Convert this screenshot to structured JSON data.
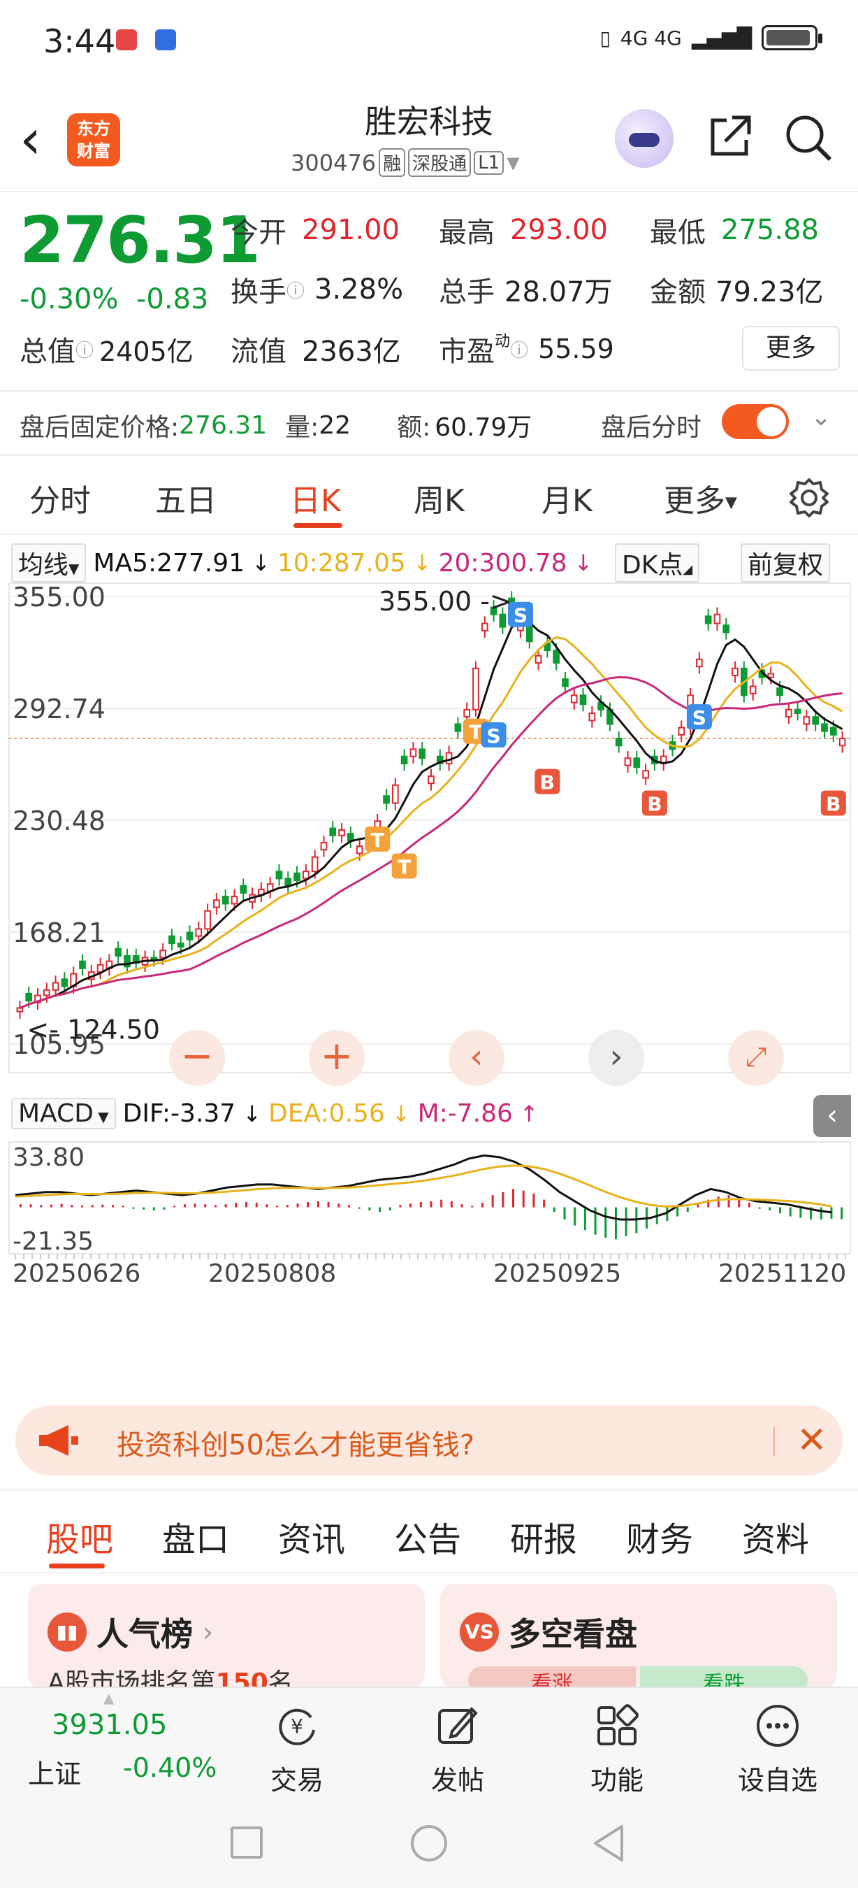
{
  "status_bar": {
    "time": "3:44",
    "network": "4G 4G"
  },
  "header": {
    "stock_name": "胜宏科技",
    "stock_code": "300476",
    "tags": [
      "融",
      "深股通",
      "L1"
    ],
    "logo_text_1": "东方",
    "logo_text_2": "财富"
  },
  "quote": {
    "price": "276.31",
    "change_pct": "-0.30%",
    "change_val": "-0.83",
    "open_label": "今开",
    "open": "291.00",
    "high_label": "最高",
    "high": "293.00",
    "low_label": "最低",
    "low": "275.88",
    "turnover_label": "换手",
    "turnover": "3.28%",
    "volume_label": "总手",
    "volume": "28.07万",
    "amount_label": "金额",
    "amount": "79.23亿",
    "mktcap_label": "总值",
    "mktcap": "2405亿",
    "float_label": "流值",
    "float": "2363亿",
    "pe_label": "市盈",
    "pe_sup": "动",
    "pe": "55.59",
    "more_label": "更多"
  },
  "after_hours": {
    "price_label": "盘后固定价格:",
    "price": "276.31",
    "qty_label": "量:",
    "qty": "22",
    "amount_label": "额:",
    "amount": "60.79万",
    "toggle_label": "盘后分时",
    "toggle_on": true
  },
  "period_tabs": [
    "分时",
    "五日",
    "日K",
    "周K",
    "月K",
    "更多"
  ],
  "active_period": "日K",
  "ma_bar": {
    "selector": "均线",
    "ma5": "MA5:277.91",
    "ma10": "10:287.05",
    "ma20": "20:300.78",
    "dk_label": "DK点",
    "adjust_label": "前复权"
  },
  "colors": {
    "up": "#e0262e",
    "down": "#0e9b34",
    "accent": "#e8401f",
    "ma5": "#111111",
    "ma10": "#e8b21d",
    "ma20": "#c8287a"
  },
  "chart_data": {
    "type": "candlestick",
    "y_labels": [
      "355.00",
      "292.74",
      "230.48",
      "168.21",
      "105.95"
    ],
    "ylim": [
      105.95,
      355.0
    ],
    "max_label": "355.00",
    "min_label": "124.50",
    "x_labels": [
      "20250626",
      "20250808",
      "20250925",
      "20251120"
    ],
    "markers": {
      "T": [
        "T",
        "T",
        "T",
        "T"
      ],
      "S": [
        "S",
        "S",
        "S"
      ],
      "B": [
        "B",
        "B",
        "B"
      ]
    },
    "closes": [
      126,
      130,
      133,
      136,
      140,
      138,
      145,
      148,
      146,
      150,
      152,
      155,
      149,
      151,
      154,
      153,
      158,
      162,
      160,
      164,
      170,
      180,
      186,
      184,
      188,
      190,
      189,
      192,
      195,
      198,
      194,
      197,
      202,
      210,
      218,
      222,
      225,
      219,
      216,
      222,
      230,
      240,
      250,
      262,
      270,
      265,
      255,
      262,
      268,
      280,
      292,
      315,
      340,
      345,
      338,
      350,
      340,
      330,
      322,
      325,
      318,
      305,
      300,
      295,
      290,
      292,
      284,
      272,
      265,
      260,
      258,
      262,
      266,
      270,
      282,
      300,
      320,
      340,
      345,
      335,
      315,
      300,
      305,
      310,
      312,
      300,
      292,
      290,
      288,
      284,
      280,
      278,
      276
    ],
    "macd": {
      "dif_label": "DIF:-3.37",
      "dea_label": "DEA:0.56",
      "m_label": "M:-7.86",
      "y_labels": [
        "33.80",
        "-21.35"
      ],
      "ylim": [
        -21.35,
        33.8
      ],
      "hist": [
        2,
        2,
        1.5,
        1.8,
        2.2,
        1.6,
        1.2,
        1.5,
        1.8,
        1.5,
        1.0,
        -1.0,
        -1.5,
        -2.0,
        -1.5,
        1.0,
        2.0,
        2.5,
        2.0,
        1.5,
        2.0,
        3.0,
        3.5,
        3.0,
        2.0,
        1.0,
        1.5,
        2.5,
        3.5,
        4.0,
        3.5,
        2.5,
        1.5,
        -1.0,
        -2.0,
        -3.0,
        -2.0,
        1.5,
        2.5,
        3.5,
        4.0,
        5.0,
        4.0,
        2.0,
        1.0,
        3.0,
        8.0,
        10.0,
        12.0,
        11.0,
        9.0,
        5.0,
        -3.0,
        -8.0,
        -12.0,
        -15.0,
        -18.0,
        -20.0,
        -21.0,
        -19.0,
        -17.0,
        -14.0,
        -11.0,
        -9.0,
        -6.0,
        -3.0,
        2.0,
        5.0,
        7.0,
        8.0,
        6.0,
        3.0,
        -1.0,
        -2.0,
        -4.0,
        -6.0,
        -7.0,
        -8.0,
        -8.0,
        -7.5,
        -7.86
      ],
      "dif": [
        8,
        9,
        10,
        10,
        9,
        8,
        9,
        10,
        11,
        10,
        9,
        8,
        9,
        11,
        13,
        14,
        15,
        15,
        14,
        13,
        12,
        13,
        14,
        16,
        18,
        19,
        20,
        22,
        25,
        28,
        32,
        34,
        33,
        30,
        25,
        18,
        10,
        4,
        -2,
        -6,
        -8,
        -8,
        -7,
        -4,
        2,
        8,
        12,
        10,
        6,
        4,
        3,
        2,
        0,
        -2,
        -3.37
      ],
      "dea": [
        7,
        7.5,
        8,
        8.5,
        8.8,
        8.7,
        8.7,
        9,
        9.4,
        9.6,
        9.5,
        9.2,
        9.2,
        9.6,
        10.3,
        11.1,
        11.9,
        12.5,
        12.8,
        12.8,
        12.6,
        12.7,
        13,
        13.6,
        14.5,
        15.4,
        16.3,
        17.5,
        19,
        20.8,
        23,
        25.2,
        26.8,
        27.4,
        26.9,
        25.1,
        22.1,
        18.5,
        14.4,
        10.3,
        6.6,
        3.7,
        1.6,
        0.5,
        0.8,
        2.2,
        4.2,
        5.3,
        5.4,
        5.1,
        4.7,
        4.2,
        3.4,
        2.3,
        0.56
      ]
    }
  },
  "macd_bar": {
    "selector": "MACD"
  },
  "ad_banner": {
    "text": "投资科创50怎么才能更省钱?"
  },
  "content_tabs": [
    "股吧",
    "盘口",
    "资讯",
    "公告",
    "研报",
    "财务",
    "资料"
  ],
  "active_content_tab": "股吧",
  "cards": {
    "popularity_title": "人气榜",
    "popularity_sub_prefix": "A股市场排名第",
    "popularity_rank": "150",
    "popularity_sub_suffix": "名",
    "bullbear_title": "多空看盘",
    "bull_label": "看涨",
    "bear_label": "看跌"
  },
  "bottom_nav": {
    "index_value": "3931.05",
    "index_name": "上证",
    "index_change": "-0.40%",
    "items": [
      "交易",
      "发帖",
      "功能",
      "设自选"
    ]
  }
}
